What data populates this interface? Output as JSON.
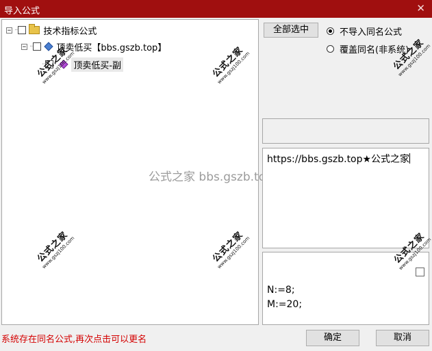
{
  "window": {
    "title": "导入公式",
    "close_glyph": "✕"
  },
  "tree": {
    "root": {
      "expander": "⊟",
      "label": "技术指标公式",
      "checked": false
    },
    "child": {
      "expander": "⊟",
      "label": "顶卖低买【bbs.gszb.top】",
      "checked": false
    },
    "leaf": {
      "label": "顶卖低买-副",
      "checked": false,
      "selected": true
    }
  },
  "watermark": {
    "cn": "公式之家",
    "url": "www.gszj100.com",
    "center_text": "公式之家 bbs.gszb.top"
  },
  "options": {
    "select_all_label": "全部选中",
    "radio_no_import_label": "不导入同名公式",
    "radio_overwrite_label": "覆盖同名(非系统)",
    "selected_radio": "no_import"
  },
  "description": {
    "text": "https://bbs.gszb.top★公式之家"
  },
  "code": {
    "line1": "N:=8;",
    "line2": " M:=20;"
  },
  "footer": {
    "status_text": "系统存在同名公式,再次点击可以更名",
    "ok_label": "确定",
    "cancel_label": "取消"
  },
  "colors": {
    "titlebar": "#a00f0f",
    "status_text": "#d40000"
  }
}
